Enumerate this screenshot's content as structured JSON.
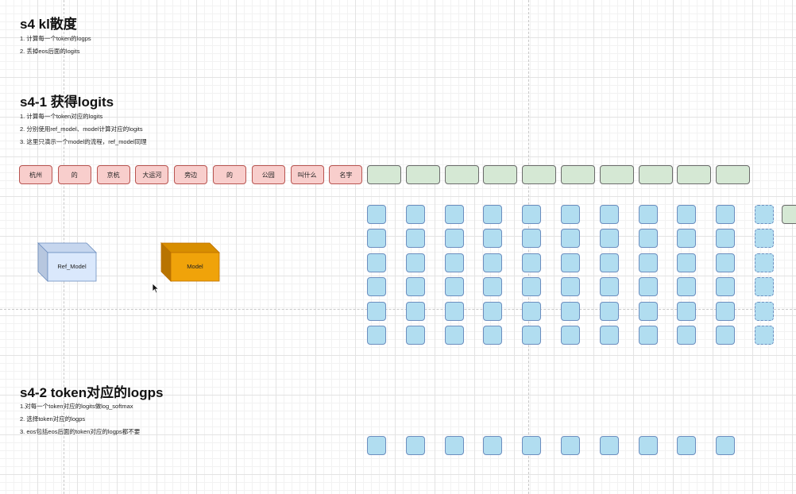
{
  "section_s4": {
    "title": "s4 kl散度",
    "steps": [
      "1. 计算每一个token的logps",
      "2. 丢掉eos后面的logits"
    ]
  },
  "section_s4_1": {
    "title": "s4-1 获得logits",
    "steps": [
      "1. 计算每一个token对应的logits",
      "2. 分别使用ref_model、model计算对应的logits",
      "3. 这里只演示一个model的流程，ref_model同理"
    ]
  },
  "section_s4_2": {
    "title": "s4-2 token对应的logps",
    "steps": [
      "1.对每一个token对应的logits做log_softmax",
      "2. 选择token对应的logps",
      "3. eos包括eos后面的token对应的logps都不要"
    ]
  },
  "tokens": [
    "杭州",
    "的",
    "京杭",
    "大运河",
    "旁边",
    "的",
    "公园",
    "叫什么",
    "名字"
  ],
  "empty_token_count": 10,
  "logits_grid": {
    "rows": 6,
    "cols": 10
  },
  "logps_row": {
    "cols": 10
  },
  "models": {
    "ref_model": "Ref_Model",
    "model": "Model"
  },
  "colors": {
    "token_fill": "#f8cecc",
    "token_border": "#b85450",
    "generated_fill": "#d5e8d4",
    "cell_fill": "#b1ddf0",
    "cell_border": "#6c8ebf",
    "ref_model_fill": "#dae8fc",
    "model_fill": "#f0a30a"
  },
  "icons": [
    "mouse-pointer-icon"
  ]
}
